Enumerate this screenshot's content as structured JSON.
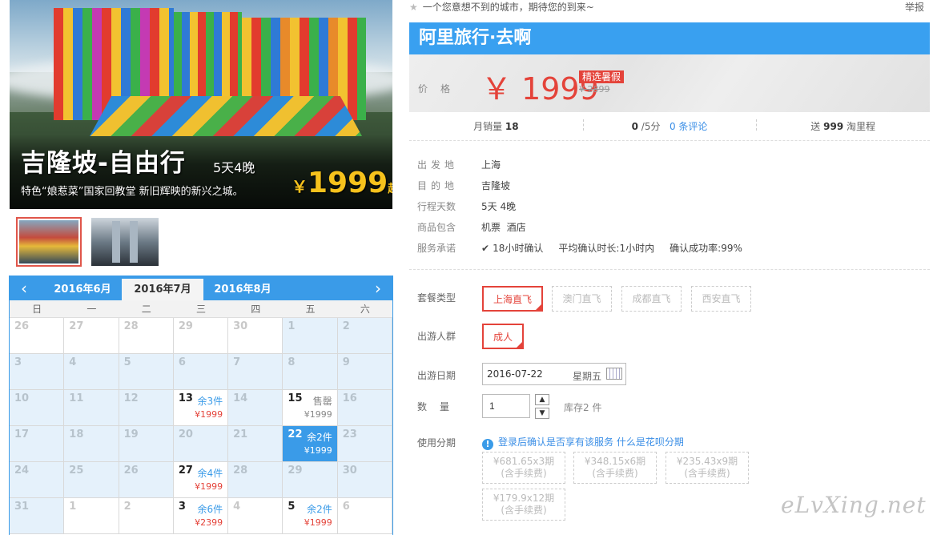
{
  "hero": {
    "title": "吉隆坡-自由行",
    "subtitle": "5天4晚",
    "desc": "特色“娘惹菜”国家回教堂 新旧辉映的新兴之城。",
    "price_symbol": "￥",
    "price": "1999",
    "price_suffix": "起"
  },
  "calendar": {
    "prev_icon": "chevron-left-icon",
    "next_icon": "chevron-right-icon",
    "months": [
      "2016年6月",
      "2016年7月",
      "2016年8月"
    ],
    "active_month": "2016年7月",
    "weekdays": [
      "日",
      "一",
      "二",
      "三",
      "四",
      "五",
      "六"
    ],
    "days": [
      {
        "d": "26"
      },
      {
        "d": "27"
      },
      {
        "d": "28"
      },
      {
        "d": "29"
      },
      {
        "d": "30"
      },
      {
        "d": "1",
        "blue": true
      },
      {
        "d": "2",
        "blue": true
      },
      {
        "d": "3",
        "blue": true
      },
      {
        "d": "4",
        "blue": true
      },
      {
        "d": "5",
        "blue": true
      },
      {
        "d": "6",
        "blue": true
      },
      {
        "d": "7",
        "blue": true
      },
      {
        "d": "8",
        "blue": true
      },
      {
        "d": "9",
        "blue": true
      },
      {
        "d": "10",
        "blue": true
      },
      {
        "d": "11",
        "blue": true
      },
      {
        "d": "12",
        "blue": true
      },
      {
        "d": "13",
        "stock": "余3件",
        "price": "¥1999"
      },
      {
        "d": "14",
        "blue": true
      },
      {
        "d": "15",
        "stock": "售罄",
        "price": "¥1999",
        "sold": true
      },
      {
        "d": "16",
        "blue": true
      },
      {
        "d": "17",
        "blue": true
      },
      {
        "d": "18",
        "blue": true
      },
      {
        "d": "19",
        "blue": true
      },
      {
        "d": "20",
        "blue": true
      },
      {
        "d": "21",
        "blue": true
      },
      {
        "d": "22",
        "stock": "余2件",
        "price": "¥1999",
        "selected": true
      },
      {
        "d": "23",
        "blue": true
      },
      {
        "d": "24",
        "blue": true
      },
      {
        "d": "25",
        "blue": true
      },
      {
        "d": "26",
        "blue": true
      },
      {
        "d": "27",
        "stock": "余4件",
        "price": "¥1999"
      },
      {
        "d": "28",
        "blue": true
      },
      {
        "d": "29",
        "blue": true
      },
      {
        "d": "30",
        "blue": true
      },
      {
        "d": "31",
        "blue": true
      },
      {
        "d": "1"
      },
      {
        "d": "2"
      },
      {
        "d": "3",
        "stock": "余6件",
        "price": "¥2399"
      },
      {
        "d": "4"
      },
      {
        "d": "5",
        "stock": "余2件",
        "price": "¥1999"
      },
      {
        "d": "6"
      }
    ]
  },
  "header": {
    "tagline": "一个您意想不到的城市，期待您的到来~",
    "star_icon": "star-icon",
    "report": "举报"
  },
  "brand": "阿里旅行·去啊",
  "price": {
    "label": "价格",
    "current": "￥ 1999",
    "tag": "精选暑假",
    "original": "¥ 2899"
  },
  "stats": {
    "sales_label": "月销量",
    "sales_value": "18",
    "rating_value": "0",
    "rating_suffix": "/5分",
    "comments": "0 条评论",
    "points_prefix": "送",
    "points_value": "999",
    "points_suffix": "淘里程"
  },
  "info": [
    {
      "label": "出发地",
      "value": "上海"
    },
    {
      "label": "目的地",
      "value": "吉隆坡"
    },
    {
      "label": "行程天数",
      "value": "5天 4晚"
    },
    {
      "label": "商品包含",
      "value": "机票  酒店"
    },
    {
      "label": "服务承诺",
      "value": "18小时确认     平均确认时长:1小时内     确认成功率:99%"
    }
  ],
  "options": {
    "package_label": "套餐类型",
    "packages": [
      "上海直飞",
      "澳门直飞",
      "成都直飞",
      "西安直飞"
    ],
    "crowd_label": "出游人群",
    "crowd": "成人",
    "date_label": "出游日期",
    "date_value": "2016-07-22",
    "date_week": "星期五",
    "qty_label": "数量",
    "qty_value": "1",
    "stock": "库存2 件",
    "installment_label": "使用分期",
    "installment_note": "登录后确认是否享有该服务",
    "installment_link": "什么是花呗分期",
    "plans": [
      {
        "amount": "¥681.65x3期",
        "fee": "(含手续费)"
      },
      {
        "amount": "¥348.15x6期",
        "fee": "(含手续费)"
      },
      {
        "amount": "¥235.43x9期",
        "fee": "(含手续费)"
      },
      {
        "amount": "¥179.9x12期",
        "fee": "(含手续费)"
      }
    ]
  },
  "watermark": "eLvXing.net"
}
